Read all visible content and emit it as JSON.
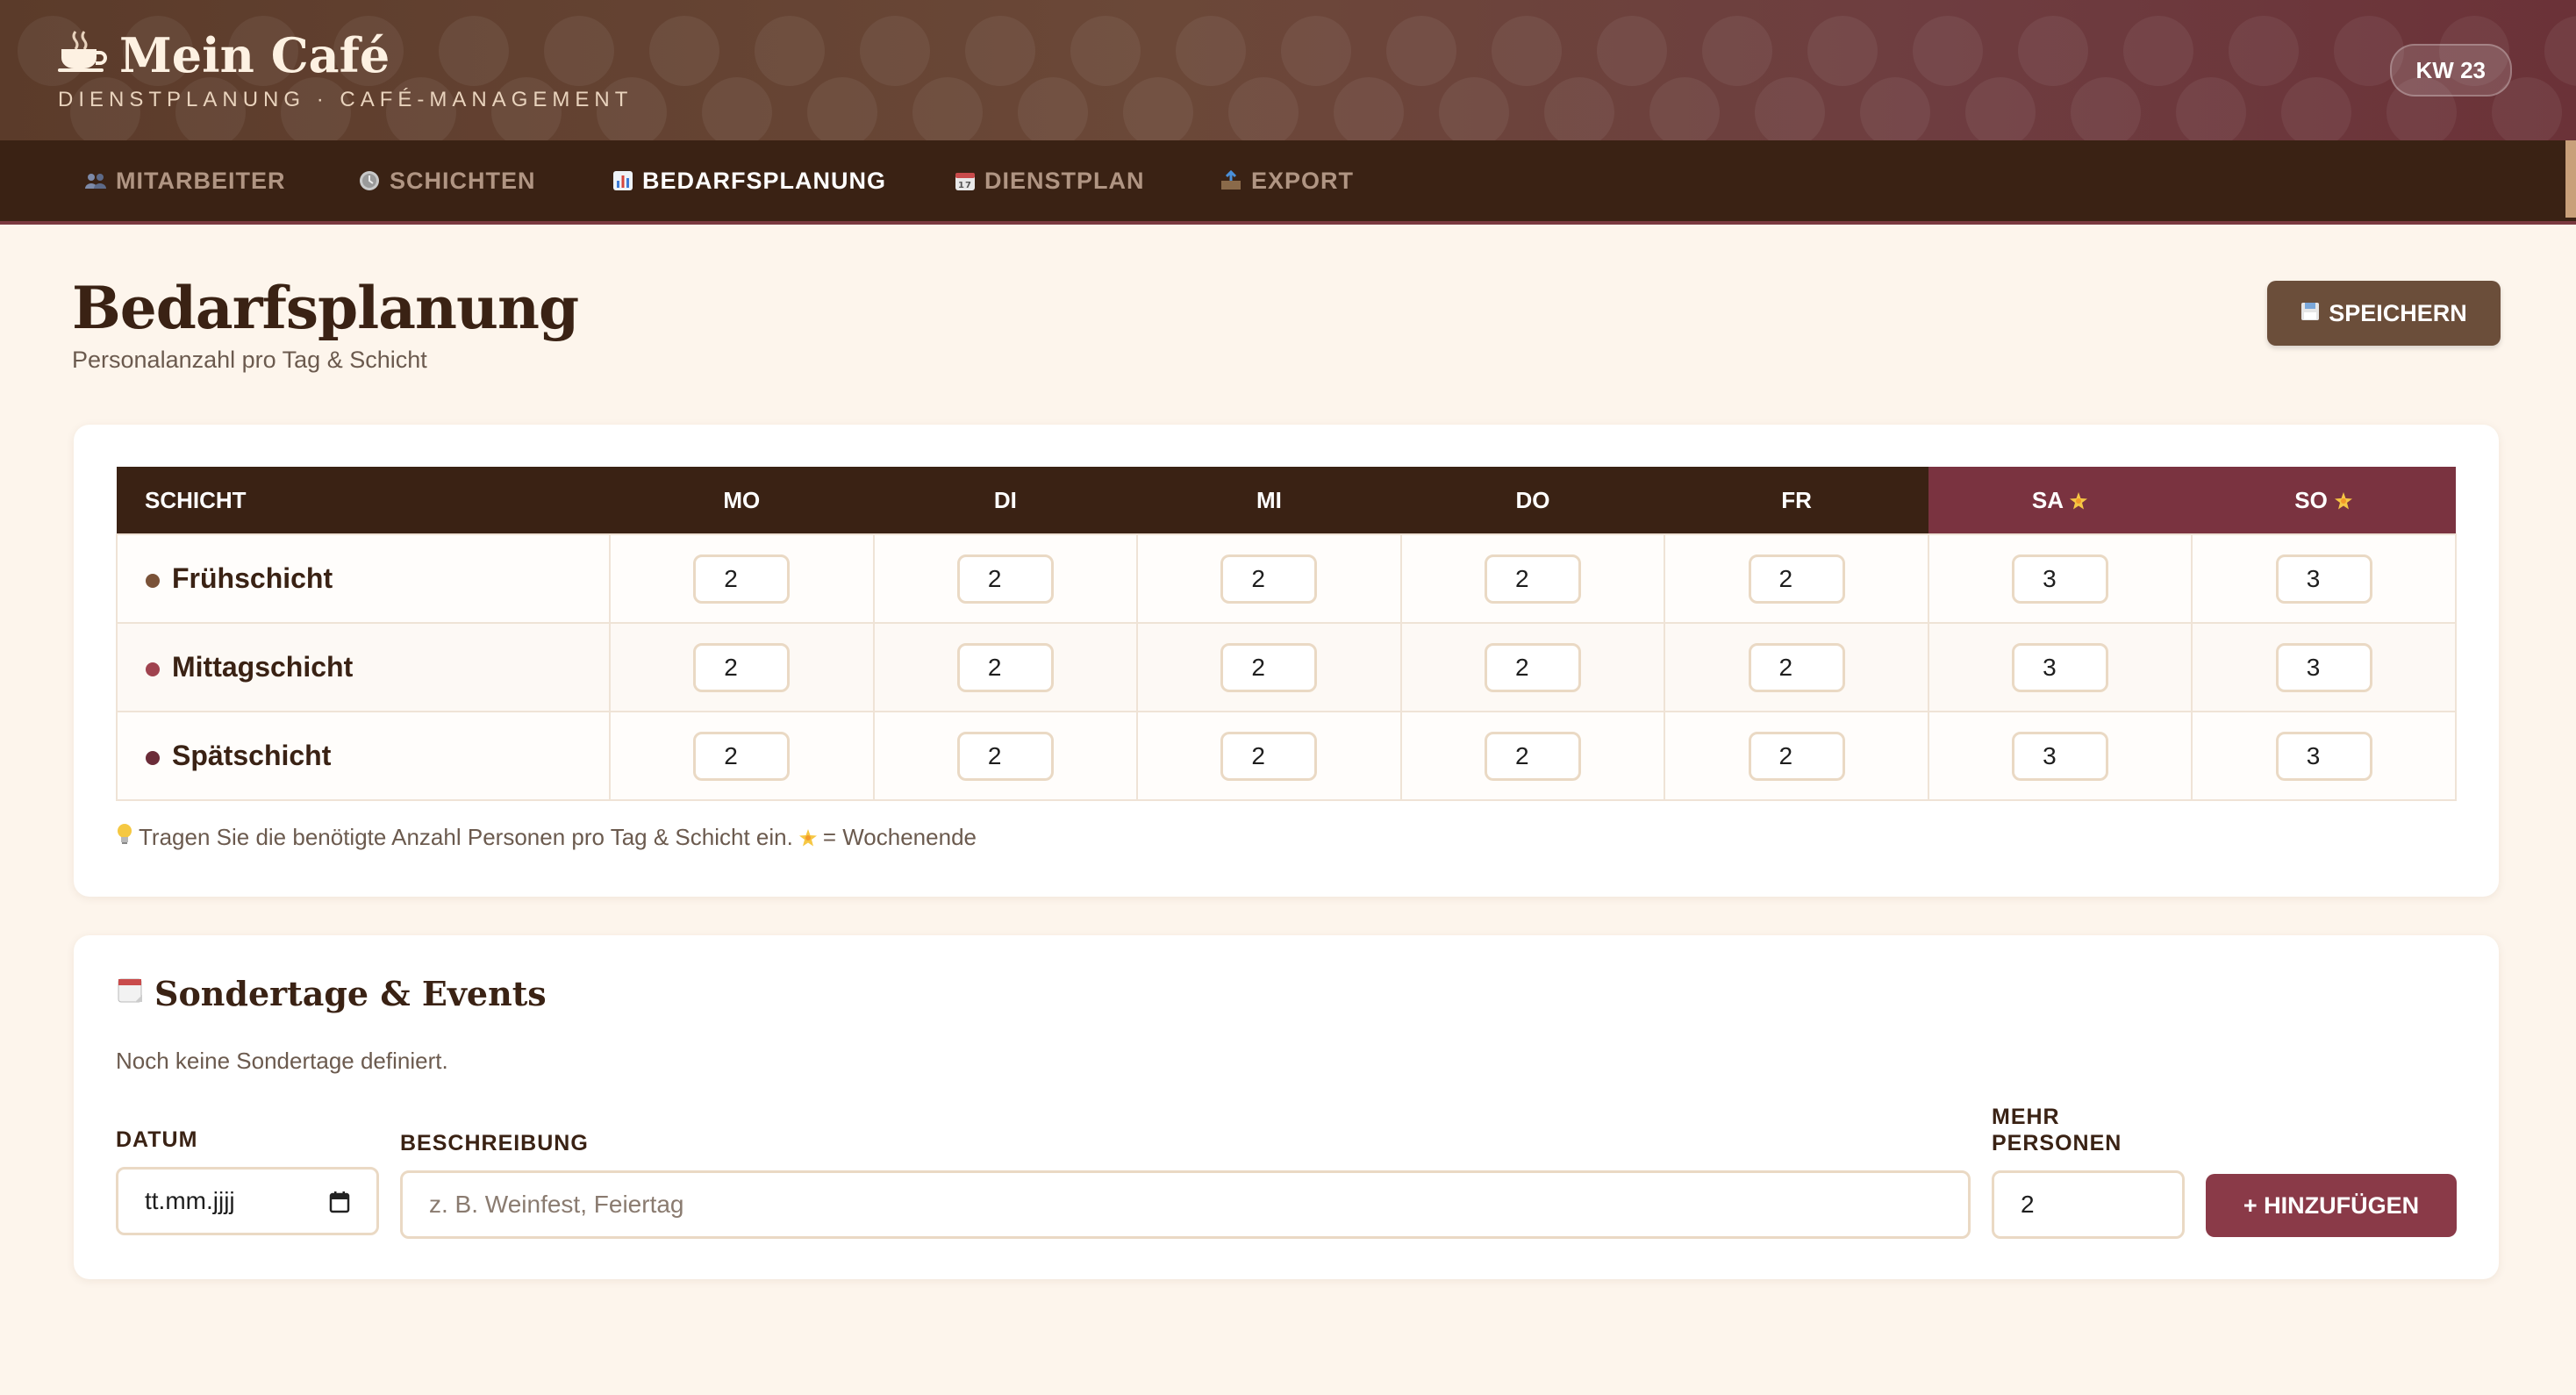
{
  "app": {
    "title": "Mein Café",
    "subtitle": "DIENSTPLANUNG · CAFÉ-MANAGEMENT",
    "week_badge": "KW 23"
  },
  "nav": {
    "items": [
      {
        "label": "MITARBEITER",
        "icon": "people-icon"
      },
      {
        "label": "SCHICHTEN",
        "icon": "clock-icon"
      },
      {
        "label": "BEDARFSPLANUNG",
        "icon": "bar-chart-icon",
        "active": true
      },
      {
        "label": "DIENSTPLAN",
        "icon": "calendar-icon"
      },
      {
        "label": "EXPORT",
        "icon": "outbox-icon"
      }
    ]
  },
  "page": {
    "title": "Bedarfsplanung",
    "subtitle": "Personalanzahl pro Tag & Schicht",
    "save_label": "SPEICHERN"
  },
  "table": {
    "header_first": "SCHICHT",
    "days": [
      {
        "label": "MO",
        "weekend": false
      },
      {
        "label": "DI",
        "weekend": false
      },
      {
        "label": "MI",
        "weekend": false
      },
      {
        "label": "DO",
        "weekend": false
      },
      {
        "label": "FR",
        "weekend": false
      },
      {
        "label": "SA",
        "weekend": true
      },
      {
        "label": "SO",
        "weekend": true
      }
    ],
    "rows": [
      {
        "name": "Frühschicht",
        "color": "#7a5238",
        "values": [
          "2",
          "2",
          "2",
          "2",
          "2",
          "3",
          "3"
        ]
      },
      {
        "name": "Mittagschicht",
        "color": "#a0434f",
        "values": [
          "2",
          "2",
          "2",
          "2",
          "2",
          "3",
          "3"
        ]
      },
      {
        "name": "Spätschicht",
        "color": "#6b2c38",
        "values": [
          "2",
          "2",
          "2",
          "2",
          "2",
          "3",
          "3"
        ]
      }
    ],
    "hint_part1": "Tragen Sie die benötigte Anzahl Personen pro Tag & Schicht ein.",
    "hint_part2": "= Wochenende"
  },
  "special": {
    "title": "Sondertage & Events",
    "empty_text": "Noch keine Sondertage definiert.",
    "date_label": "DATUM",
    "date_value": "tt.mm.jjjj",
    "desc_label": "BESCHREIBUNG",
    "desc_placeholder": "z. B. Weinfest, Feiertag",
    "more_label_1": "MEHR",
    "more_label_2": "PERSONEN",
    "more_value": "2",
    "add_label": "+ HINZUFÜGEN"
  },
  "colors": {
    "dark_brown": "#3a2214",
    "weekend_header": "#7a3340",
    "save_button": "#6b4e3a",
    "add_button": "#8a3a48",
    "background": "#fdf5ec"
  }
}
